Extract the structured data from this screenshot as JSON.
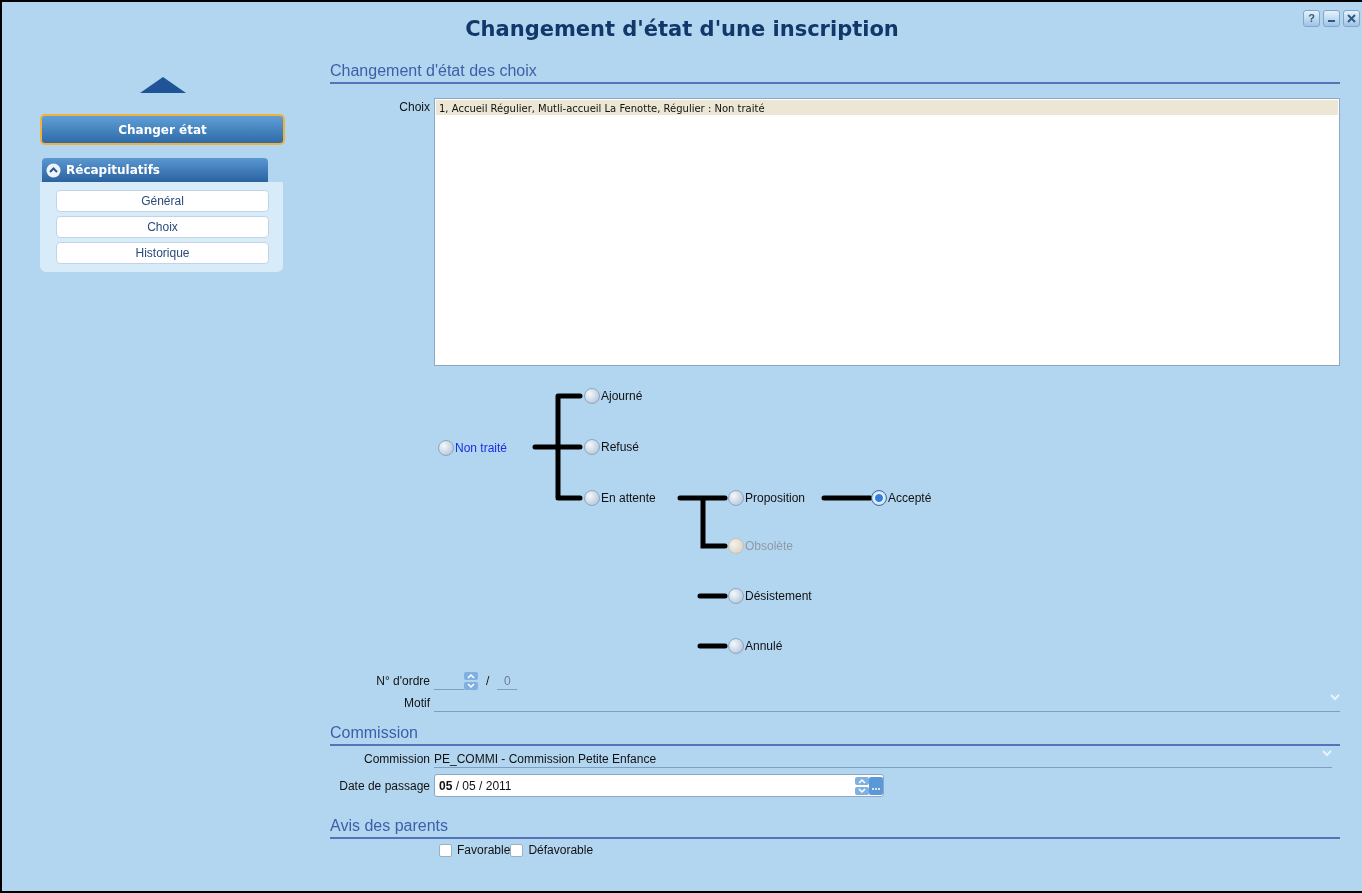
{
  "window": {
    "title": "Changement d'état d'une inscription",
    "buttons": [
      "?"
    ]
  },
  "sidebar": {
    "action": "Changer état",
    "group": {
      "title": "Récapitulatifs",
      "expanded": true,
      "items": [
        "Général",
        "Choix",
        "Historique"
      ]
    }
  },
  "choices_section": {
    "title": "Changement d'état des choix",
    "label": "Choix",
    "rows": [
      {
        "text": "1, Accueil  Régulier, Mutli-accueil La Fenotte, Régulier : Non traité",
        "selected": true
      }
    ]
  },
  "states": [
    {
      "label": "Non traité",
      "current": true,
      "selected": false,
      "disabled": false
    },
    {
      "label": "Ajourné",
      "current": false,
      "selected": false,
      "disabled": false
    },
    {
      "label": "Refusé",
      "current": false,
      "selected": false,
      "disabled": false
    },
    {
      "label": "En attente",
      "current": false,
      "selected": false,
      "disabled": false
    },
    {
      "label": "Proposition",
      "current": false,
      "selected": false,
      "disabled": false
    },
    {
      "label": "Accepté",
      "current": false,
      "selected": true,
      "disabled": false
    },
    {
      "label": "Obsolète",
      "current": false,
      "selected": false,
      "disabled": true
    },
    {
      "label": "Désistement",
      "current": false,
      "selected": false,
      "disabled": false
    },
    {
      "label": "Annulé",
      "current": false,
      "selected": false,
      "disabled": false
    }
  ],
  "order": {
    "label": "N° d'ordre",
    "separator": "/",
    "total": "0"
  },
  "motif": {
    "label": "Motif"
  },
  "commission_section": {
    "title": "Commission",
    "commission_label": "Commission",
    "commission_value": "PE_COMMI - Commission Petite Enfance",
    "date_label": "Date de passage",
    "date_day": "05",
    "date_rest": " / 05 / 2011"
  },
  "parents_section": {
    "title": "Avis des parents",
    "options": [
      {
        "label": "Favorable",
        "checked": false
      },
      {
        "label": "Défavorable",
        "checked": false
      }
    ]
  }
}
